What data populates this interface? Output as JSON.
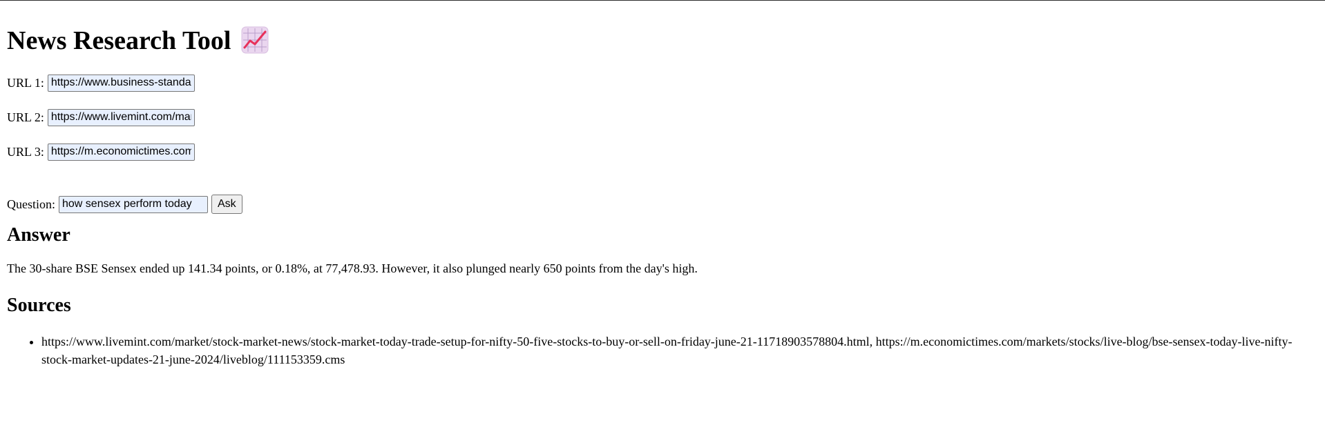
{
  "header": {
    "title": "News Research Tool",
    "icon": "chart-increasing-icon"
  },
  "form": {
    "url1_label": "URL 1:",
    "url1_value": "https://www.business-standard.com/",
    "url2_label": "URL 2:",
    "url2_value": "https://www.livemint.com/market/stock-market-news/stock-market-today-trade-setup-for-nifty-50-five-stocks-to-buy-or-sell-on-friday-june-21-11718903578804.html",
    "url3_label": "URL 3:",
    "url3_value": "https://m.economictimes.com/markets/stocks/live-blog/bse-sensex-today-live-nifty-stock-market-updates-21-june-2024/liveblog/111153359.cms",
    "question_label": "Question:",
    "question_value": "how sensex perform today",
    "ask_label": "Ask"
  },
  "answer": {
    "heading": "Answer",
    "text": "The 30-share BSE Sensex ended up 141.34 points, or 0.18%, at 77,478.93. However, it also plunged nearly 650 points from the day's high."
  },
  "sources": {
    "heading": "Sources",
    "items": [
      "https://www.livemint.com/market/stock-market-news/stock-market-today-trade-setup-for-nifty-50-five-stocks-to-buy-or-sell-on-friday-june-21-11718903578804.html, https://m.economictimes.com/markets/stocks/live-blog/bse-sensex-today-live-nifty-stock-market-updates-21-june-2024/liveblog/111153359.cms"
    ]
  },
  "colors": {
    "input_background": "#e8f0fe",
    "chart_line": "#e8315a",
    "chart_tile": "#ead6ef"
  }
}
